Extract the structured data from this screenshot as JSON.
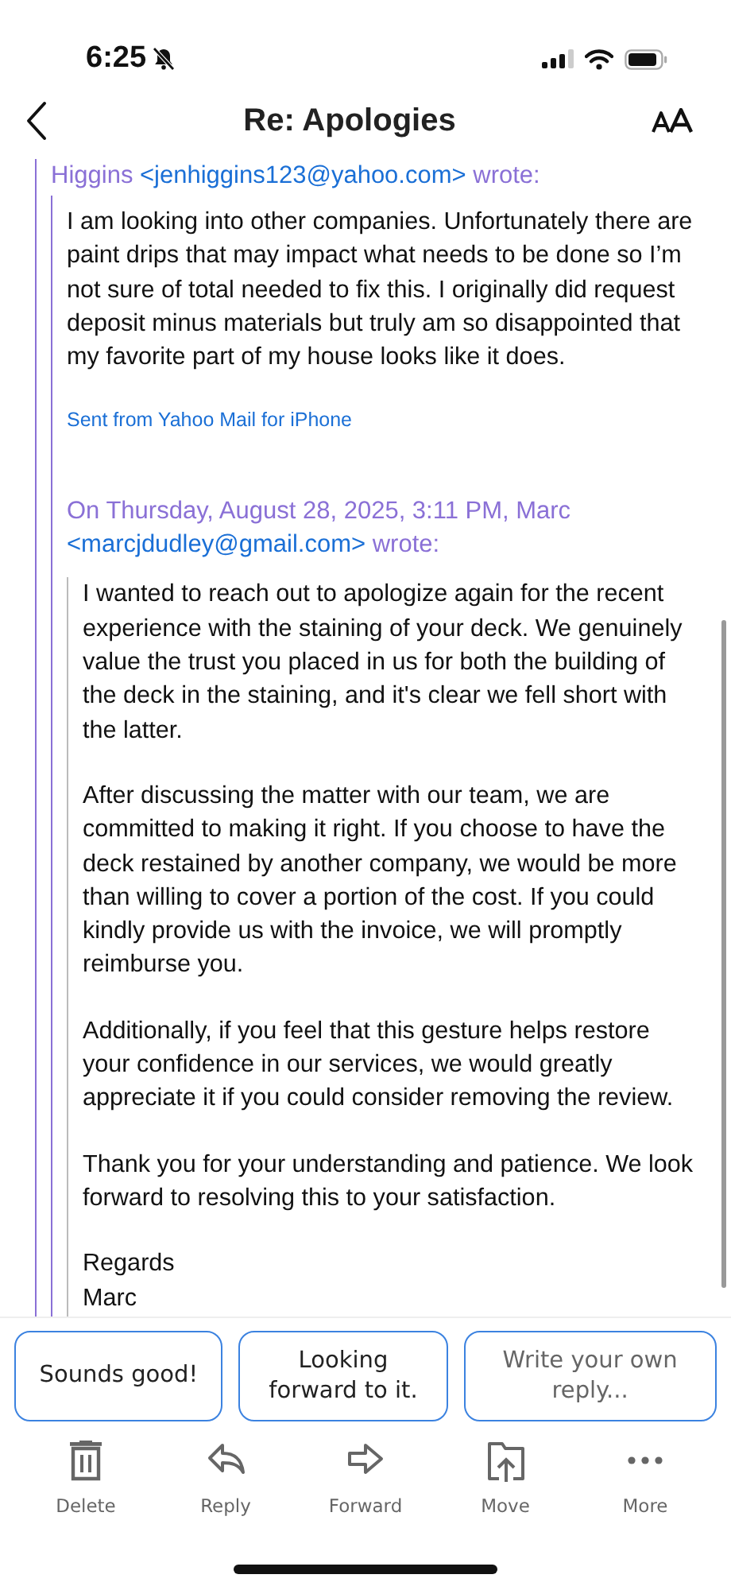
{
  "status_bar": {
    "time": "6:25"
  },
  "header": {
    "title": "Re: Apologies"
  },
  "message": {
    "quote_header": {
      "lead": "Higgins ",
      "email": "<jenhiggins123@yahoo.com>",
      "trail": " wrote:"
    },
    "paragraphs": [
      "I am looking into other companies. Unfortunately there are paint drips that may impact what needs to be done so I’m not sure of total needed to fix this. I originally did request deposit minus materials but truly am so disappointed that my favorite part of my house looks like it does."
    ],
    "signature": "Sent from Yahoo Mail for iPhone",
    "nested_header": {
      "lead": "On Thursday, August 28, 2025, 3:11 PM, Marc ",
      "email": "<marcjdudley@gmail.com>",
      "trail": " wrote:"
    },
    "nested_paragraphs": [
      "I wanted to reach out to apologize again for the recent experience with the staining of your deck. We genuinely value the trust you placed in us for both the building of the deck in the staining, and it's clear we fell short with the latter.",
      "After discussing the matter with our team, we are committed to making it right. If you choose to have the deck restained by another company, we would be more than willing to cover a portion of the cost. If you could kindly provide us with the invoice, we will promptly reimburse you.",
      "Additionally, if you feel that this gesture helps restore your confidence in our services, we would greatly appreciate it if you could consider removing the review.",
      "Thank you for your understanding and patience. We look forward to resolving this to your satisfaction.",
      "Regards\nMarc"
    ]
  },
  "quick_replies": [
    {
      "label": "Sounds good!",
      "kind": "suggestion"
    },
    {
      "label": "Looking forward to it.",
      "kind": "suggestion"
    },
    {
      "label": "Write your own reply...",
      "kind": "compose"
    }
  ],
  "toolbar": [
    {
      "label": "Delete",
      "kind": "delete"
    },
    {
      "label": "Reply",
      "kind": "reply"
    },
    {
      "label": "Forward",
      "kind": "forward"
    },
    {
      "label": "Move",
      "kind": "move"
    },
    {
      "label": "More",
      "kind": "more"
    }
  ]
}
